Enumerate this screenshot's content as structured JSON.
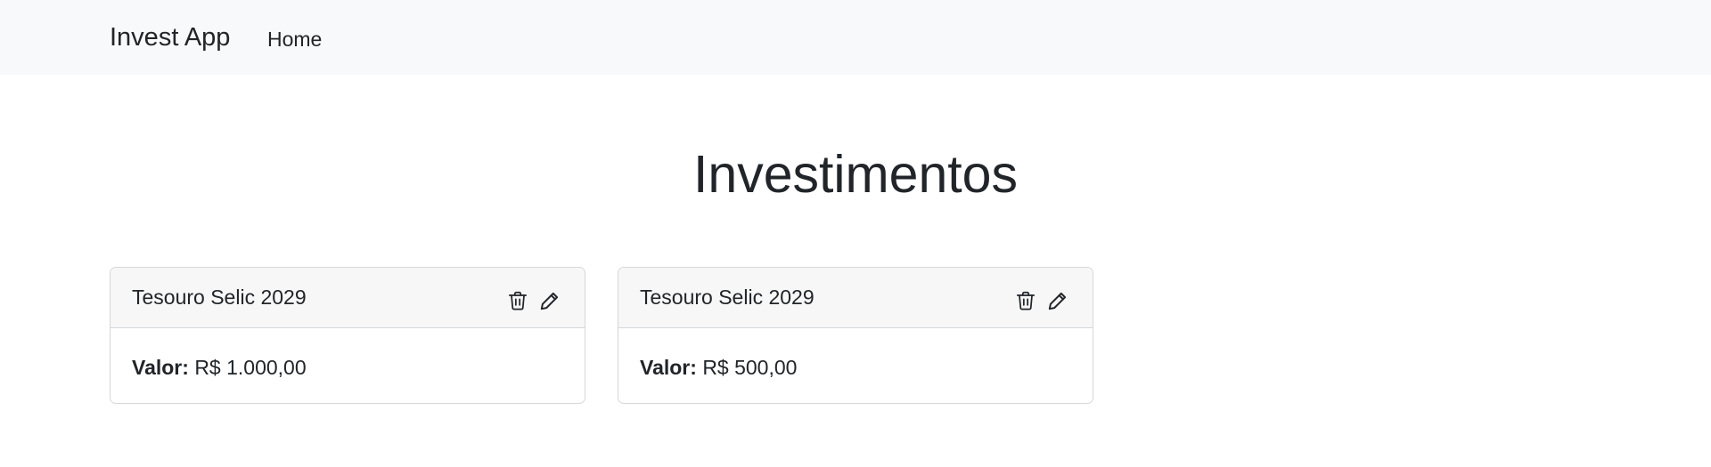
{
  "navbar": {
    "brand": "Invest App",
    "links": [
      {
        "label": "Home"
      }
    ]
  },
  "main": {
    "title": "Investimentos",
    "cards": [
      {
        "title": "Tesouro Selic 2029",
        "value_label": "Valor:",
        "value": "R$ 1.000,00",
        "icons": [
          "trash-icon",
          "pencil-icon"
        ]
      },
      {
        "title": "Tesouro Selic 2029",
        "value_label": "Valor:",
        "value": "R$ 500,00",
        "icons": [
          "trash-icon",
          "pencil-icon"
        ]
      }
    ]
  },
  "colors": {
    "navbar_bg": "#f8f9fa",
    "card_header_bg": "#f7f7f7",
    "text": "#212529",
    "border": "#d5d7da"
  }
}
